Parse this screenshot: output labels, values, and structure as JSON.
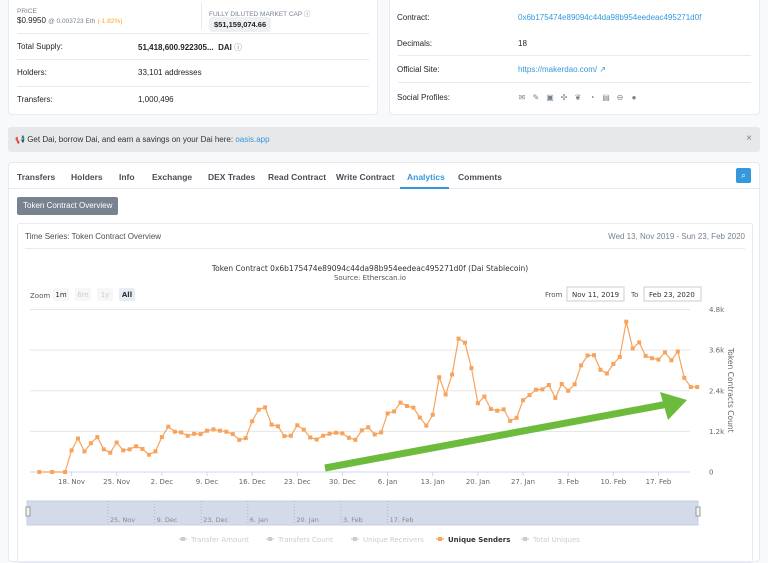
{
  "overview": {
    "price_label": "PRICE",
    "price": "$0.9950",
    "price_eth": "@ 0.003723 Eth",
    "price_change": "(-1.82%)",
    "market_cap_label": "FULLY DILUTED MARKET CAP",
    "market_cap": "$51,159,074.66",
    "total_supply_label": "Total Supply:",
    "total_supply": "51,418,600.922305...",
    "total_supply_unit": "DAI",
    "holders_label": "Holders:",
    "holders": "33,101 addresses",
    "transfers_label": "Transfers:",
    "transfers": "1,000,496"
  },
  "profile": {
    "contract_label": "Contract:",
    "contract": "0x6b175474e89094c44da98b954eedeac495271d0f",
    "decimals_label": "Decimals:",
    "decimals": "18",
    "site_label": "Official Site:",
    "site": "https://makerdao.com/",
    "social_label": "Social Profiles:",
    "social_icons": [
      "email-icon",
      "blog-icon",
      "reddit-icon",
      "slack-icon",
      "twitter-icon",
      "github-icon",
      "whitepaper-icon",
      "coinmarketcap-icon",
      "coingecko-icon"
    ]
  },
  "alert": {
    "text": "Get Dai, borrow Dai, and earn a savings on your Dai here:",
    "link": "oasis.app",
    "close": "×"
  },
  "tabs": [
    "Transfers",
    "Holders",
    "Info",
    "Exchange",
    "DEX Trades",
    "Read Contract",
    "Write Contract",
    "Analytics",
    "Comments"
  ],
  "active_tab": "Analytics",
  "overview_button": "Token Contract Overview",
  "panel": {
    "title": "Time Series: Token Contract Overview",
    "range": "Wed 13, Nov 2019 - Sun 23, Feb 2020"
  },
  "chart_data": {
    "type": "line",
    "title": "Token Contract 0x6b175474e89094c44da98b954eedeac495271d0f (Dai Stablecoin)",
    "subtitle": "Source: Etherscan.io",
    "ylabel": "Token Contracts Count",
    "ylim": [
      0,
      4800
    ],
    "yticks": [
      "0",
      "1.2k",
      "2.4k",
      "3.6k",
      "4.8k"
    ],
    "xticks": [
      "18. Nov",
      "25. Nov",
      "2. Dec",
      "9. Dec",
      "16. Dec",
      "23. Dec",
      "30. Dec",
      "6. Jan",
      "13. Jan",
      "20. Jan",
      "27. Jan",
      "3. Feb",
      "10. Feb",
      "17. Feb"
    ],
    "grid": true,
    "zoom_label": "Zoom",
    "zoom_options": [
      "1m",
      "6m",
      "1y",
      "All"
    ],
    "zoom_selected": "All",
    "from_label": "From",
    "from": "Nov 11, 2019",
    "to_label": "To",
    "to": "Feb 23, 2020",
    "navigator_ticks": [
      "25. Nov",
      "9. Dec",
      "23. Dec",
      "6. Jan",
      "20. Jan",
      "3. Feb",
      "17. Feb"
    ],
    "legend": [
      "Transfer Amount",
      "Transfers Count",
      "Unique Receivers",
      "Unique Senders",
      "Total Uniques"
    ],
    "legend_active": "Unique Senders",
    "series": [
      {
        "name": "Unique Senders",
        "color": "#f7a35c",
        "x": [
          "2019-11-13",
          "2019-11-15",
          "2019-11-17",
          "2019-11-18",
          "2019-11-19",
          "2019-11-20",
          "2019-11-21",
          "2019-11-22",
          "2019-11-23",
          "2019-11-24",
          "2019-11-25",
          "2019-11-26",
          "2019-11-27",
          "2019-11-28",
          "2019-11-29",
          "2019-11-30",
          "2019-12-01",
          "2019-12-02",
          "2019-12-03",
          "2019-12-04",
          "2019-12-05",
          "2019-12-06",
          "2019-12-07",
          "2019-12-08",
          "2019-12-09",
          "2019-12-10",
          "2019-12-11",
          "2019-12-12",
          "2019-12-13",
          "2019-12-14",
          "2019-12-15",
          "2019-12-16",
          "2019-12-17",
          "2019-12-18",
          "2019-12-19",
          "2019-12-20",
          "2019-12-21",
          "2019-12-22",
          "2019-12-23",
          "2019-12-24",
          "2019-12-25",
          "2019-12-26",
          "2019-12-27",
          "2019-12-28",
          "2019-12-29",
          "2019-12-30",
          "2019-12-31",
          "2020-01-01",
          "2020-01-02",
          "2020-01-03",
          "2020-01-04",
          "2020-01-05",
          "2020-01-06",
          "2020-01-07",
          "2020-01-08",
          "2020-01-09",
          "2020-01-10",
          "2020-01-11",
          "2020-01-12",
          "2020-01-13",
          "2020-01-14",
          "2020-01-15",
          "2020-01-16",
          "2020-01-17",
          "2020-01-18",
          "2020-01-19",
          "2020-01-20",
          "2020-01-21",
          "2020-01-22",
          "2020-01-23",
          "2020-01-24",
          "2020-01-25",
          "2020-01-26",
          "2020-01-27",
          "2020-01-28",
          "2020-01-29",
          "2020-01-30",
          "2020-01-31",
          "2020-02-01",
          "2020-02-02",
          "2020-02-03",
          "2020-02-04",
          "2020-02-05",
          "2020-02-06",
          "2020-02-07",
          "2020-02-08",
          "2020-02-09",
          "2020-02-10",
          "2020-02-11",
          "2020-02-12",
          "2020-02-13",
          "2020-02-14",
          "2020-02-15",
          "2020-02-16",
          "2020-02-17",
          "2020-02-18",
          "2020-02-19",
          "2020-02-20",
          "2020-02-21",
          "2020-02-22",
          "2020-02-23"
        ],
        "values": [
          0,
          0,
          0,
          640,
          990,
          610,
          850,
          1030,
          670,
          570,
          870,
          640,
          670,
          760,
          680,
          510,
          610,
          1030,
          1340,
          1190,
          1170,
          1070,
          1130,
          1120,
          1220,
          1260,
          1220,
          1190,
          1120,
          950,
          1000,
          1500,
          1840,
          1910,
          1400,
          1350,
          1060,
          1070,
          1380,
          1250,
          1020,
          960,
          1070,
          1130,
          1160,
          1140,
          1010,
          950,
          1230,
          1320,
          1110,
          1170,
          1730,
          1790,
          2050,
          1950,
          1900,
          1610,
          1370,
          1690,
          2800,
          2290,
          2880,
          3940,
          3820,
          3070,
          2030,
          2230,
          1860,
          1810,
          1850,
          1510,
          1600,
          2120,
          2270,
          2430,
          2440,
          2570,
          2190,
          2600,
          2400,
          2590,
          3150,
          3440,
          3450,
          3020,
          2910,
          3190,
          3400,
          4440,
          3650,
          3830,
          3430,
          3360,
          3320,
          3530,
          3300,
          3560,
          2780,
          2510,
          2510
        ]
      }
    ],
    "annotation_color": "#6dbb3d"
  }
}
